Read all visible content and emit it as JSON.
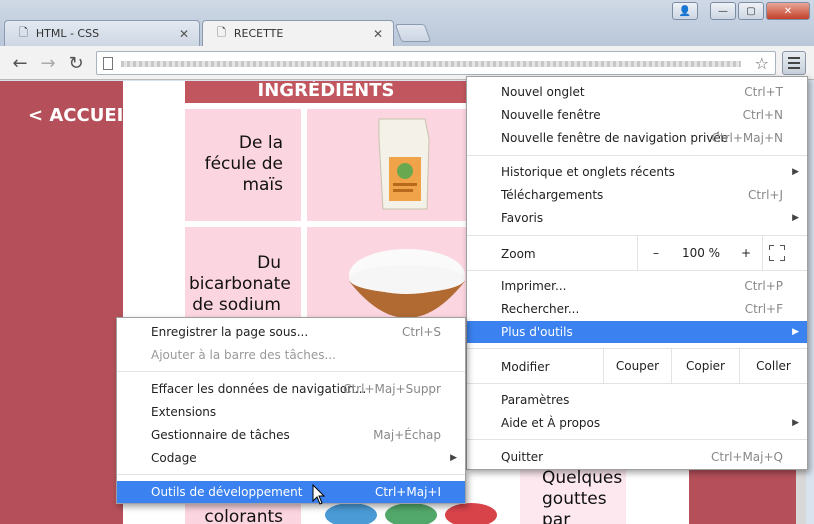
{
  "browser": {
    "tabs": [
      {
        "title": "HTML - CSS",
        "active": false
      },
      {
        "title": "RECETTE",
        "active": true
      }
    ],
    "window_controls": {
      "user": "👤",
      "minimize": "—",
      "maximize": "▢",
      "close": "✕"
    },
    "icons": {
      "back": "back-arrow-icon",
      "forward": "forward-arrow-icon",
      "reload": "reload-icon",
      "star": "star-icon",
      "menu": "hamburger-menu-icon"
    }
  },
  "page": {
    "accueil": "< ACCUEIL",
    "ingredients_header": "INGRÉDIENTS",
    "rows": [
      {
        "text_lines": [
          "De la",
          "fécule de",
          "maïs"
        ]
      },
      {
        "text_lines": [
          "Du",
          "bicarbonate",
          "de sodium"
        ]
      }
    ],
    "bottom_left_text": "colorants",
    "bottom_right_lines": [
      "Quelques",
      "gouttes",
      "par"
    ],
    "colors": {
      "background": "#b5505a",
      "cell": "#fbd5df",
      "header": "#c1565e"
    }
  },
  "menu": {
    "items_top": [
      {
        "label": "Nouvel onglet",
        "shortcut": "Ctrl+T"
      },
      {
        "label": "Nouvelle fenêtre",
        "shortcut": "Ctrl+N"
      },
      {
        "label": "Nouvelle fenêtre de navigation privée",
        "shortcut": "Ctrl+Maj+N"
      }
    ],
    "items_history": [
      {
        "label": "Historique et onglets récents",
        "submenu": true
      },
      {
        "label": "Téléchargements",
        "shortcut": "Ctrl+J"
      },
      {
        "label": "Favoris",
        "submenu": true
      }
    ],
    "zoom": {
      "label": "Zoom",
      "minus": "–",
      "value": "100 %",
      "plus": "+"
    },
    "items_tools": [
      {
        "label": "Imprimer...",
        "shortcut": "Ctrl+P"
      },
      {
        "label": "Rechercher...",
        "shortcut": "Ctrl+F"
      },
      {
        "label": "Plus d'outils",
        "submenu": true,
        "highlighted": true
      }
    ],
    "edit": {
      "label": "Modifier",
      "cut": "Couper",
      "copy": "Copier",
      "paste": "Coller"
    },
    "items_settings": [
      {
        "label": "Paramètres"
      },
      {
        "label": "Aide et À propos",
        "submenu": true
      }
    ],
    "quit": {
      "label": "Quitter",
      "shortcut": "Ctrl+Maj+Q"
    },
    "highlight_color": "#3b82f0"
  },
  "submenu": {
    "items": [
      {
        "label": "Enregistrer la page sous...",
        "shortcut": "Ctrl+S"
      },
      {
        "label": "Ajouter à la barre des tâches...",
        "disabled": true
      },
      {
        "label": "Effacer les données de navigation...",
        "shortcut": "Ctrl+Maj+Suppr"
      },
      {
        "label": "Extensions"
      },
      {
        "label": "Gestionnaire de tâches",
        "shortcut": "Maj+Échap"
      },
      {
        "label": "Codage",
        "submenu": true
      },
      {
        "label": "Outils de développement",
        "shortcut": "Ctrl+Maj+I",
        "highlighted": true
      }
    ]
  },
  "arrow_glyph": "▶"
}
